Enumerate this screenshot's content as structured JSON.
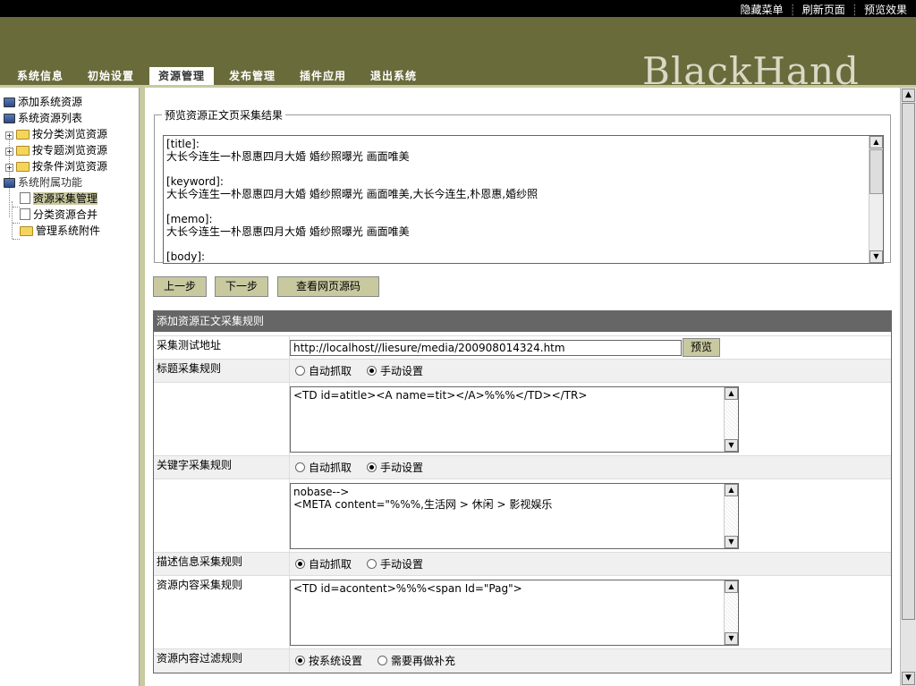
{
  "topbar": {
    "links": [
      "隐藏菜单",
      "刷新页面",
      "预览效果"
    ]
  },
  "header": {
    "logo_text": "BlackHand",
    "nav": [
      {
        "label": "系统信息",
        "active": false
      },
      {
        "label": "初始设置",
        "active": false
      },
      {
        "label": "资源管理",
        "active": true
      },
      {
        "label": "发布管理",
        "active": false
      },
      {
        "label": "插件应用",
        "active": false
      },
      {
        "label": "退出系统",
        "active": false
      }
    ]
  },
  "sidebar": {
    "items": [
      {
        "label": "添加系统资源",
        "icon": "computer-icon"
      },
      {
        "label": "系统资源列表",
        "icon": "computer-icon"
      },
      {
        "label": "按分类浏览资源",
        "icon": "folder-icon"
      },
      {
        "label": "按专题浏览资源",
        "icon": "folder-icon"
      },
      {
        "label": "按条件浏览资源",
        "icon": "folder-icon"
      },
      {
        "label": "系统附属功能",
        "icon": "computer-icon"
      },
      {
        "label": "资源采集管理",
        "icon": "document-icon",
        "selected": true
      },
      {
        "label": "分类资源合并",
        "icon": "document-icon"
      },
      {
        "label": "管理系统附件",
        "icon": "folder-icon"
      }
    ]
  },
  "preview": {
    "legend": "预览资源正文页采集结果",
    "lines": [
      "[title]:",
      "大长今连生一朴恩惠四月大婚 婚纱照曝光 画面唯美",
      "",
      "[keyword]:",
      "大长今连生一朴恩惠四月大婚 婚纱照曝光 画面唯美,大长今连生,朴恩惠,婚纱照",
      "",
      "[memo]:",
      "大长今连生一朴恩惠四月大婚 婚纱照曝光 画面唯美",
      "",
      "[body]:"
    ]
  },
  "buttons": {
    "prev": "上一步",
    "next": "下一步",
    "view_source": "查看网页源码",
    "preview": "预览"
  },
  "rules": {
    "header": "添加资源正文采集规则",
    "test_url_label": "采集测试地址",
    "test_url_value": "http://localhost//liesure/media/200908014324.htm",
    "title_label": "标题采集规则",
    "title_option_auto": "自动抓取",
    "title_option_manual": "手动设置",
    "title_mode": "manual",
    "title_rule": "<TD id=atitle><A name=tit></A>%%%</TD></TR>",
    "keyword_label": "关键字采集规则",
    "keyword_option_auto": "自动抓取",
    "keyword_option_manual": "手动设置",
    "keyword_mode": "manual",
    "keyword_rule": "nobase-->\n<META content=\"%%%,生活网 > 休闲 > 影视娱乐",
    "memo_label": "描述信息采集规则",
    "memo_option_auto": "自动抓取",
    "memo_option_manual": "手动设置",
    "memo_mode": "auto",
    "content_label": "资源内容采集规则",
    "content_rule": "<TD id=acontent>%%%<span Id=\"Pag\">",
    "filter_label": "资源内容过滤规则",
    "filter_option_system": "按系统设置",
    "filter_option_extra": "需要再做补充",
    "filter_mode": "system"
  },
  "colors": {
    "header_bg": "#6a6b3b",
    "accent": "#c8c99f",
    "rules_header_bg": "#666666"
  }
}
